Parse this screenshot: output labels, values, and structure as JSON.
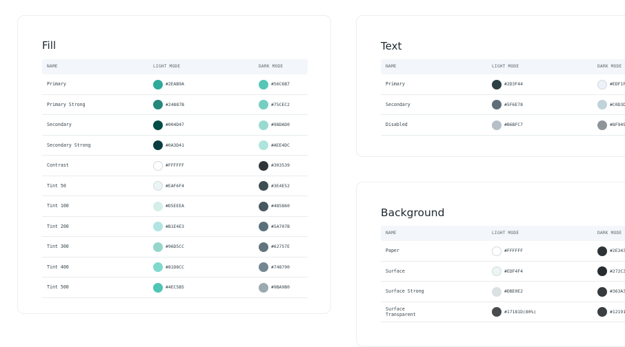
{
  "columns": {
    "name": "NAME",
    "light": "LIGHT MODE",
    "dark": "DARK MODE"
  },
  "fill": {
    "title": "Fill",
    "rows": [
      {
        "name": "Primary",
        "light": "#2EAB9A",
        "dark": "#56C6B7"
      },
      {
        "name": "Primary Strong",
        "light": "#24887B",
        "dark": "#75CEC2"
      },
      {
        "name": "Secondary",
        "light": "#004D47",
        "dark": "#98DAD0"
      },
      {
        "name": "Secondary Strong",
        "light": "#0A3D41",
        "dark": "#AEE4DC"
      },
      {
        "name": "Contrast",
        "light": "#FFFFFF",
        "dark": "#303539"
      },
      {
        "name": "Tint 50",
        "light": "#EAF6F4",
        "dark": "#3E4E52"
      },
      {
        "name": "Tint 100",
        "light": "#D5EEEA",
        "dark": "#485860"
      },
      {
        "name": "Tint 200",
        "light": "#B1E4E3",
        "dark": "#5A707B"
      },
      {
        "name": "Tint 300",
        "light": "#96D5CC",
        "dark": "#62757E"
      },
      {
        "name": "Tint 400",
        "light": "#81D8CC",
        "dark": "#748790"
      },
      {
        "name": "Tint 500",
        "light": "#4EC5B5",
        "dark": "#9BA9B0"
      }
    ]
  },
  "text": {
    "title": "Text",
    "rows": [
      {
        "name": "Primary",
        "light": "#2D3F44",
        "dark": "#EDF1F",
        "dark_color": "#EDF1FA"
      },
      {
        "name": "Secondary",
        "light": "#5F6E78",
        "dark": "#C0D3D",
        "dark_color": "#C0D3DA"
      },
      {
        "name": "Disabled",
        "light": "#B6BFC7",
        "dark": "#8F949",
        "dark_color": "#8F9499"
      }
    ]
  },
  "background": {
    "title": "Background",
    "rows": [
      {
        "name": "Paper",
        "light": "#FFFFFF",
        "dark": "#2E343",
        "dark_color": "#2E3436"
      },
      {
        "name": "Surface",
        "light": "#EDF4F4",
        "dark": "#272C3",
        "dark_color": "#272C30"
      },
      {
        "name": "Surface Strong",
        "light": "#DBE0E2",
        "dark": "#363A3",
        "dark_color": "#363A3D"
      },
      {
        "name": "Surface\nTransparent",
        "light": "#17181D(80%)",
        "light_color": "#4a4b4f",
        "dark": "#12191",
        "dark_color": "#3a3f42"
      }
    ]
  }
}
